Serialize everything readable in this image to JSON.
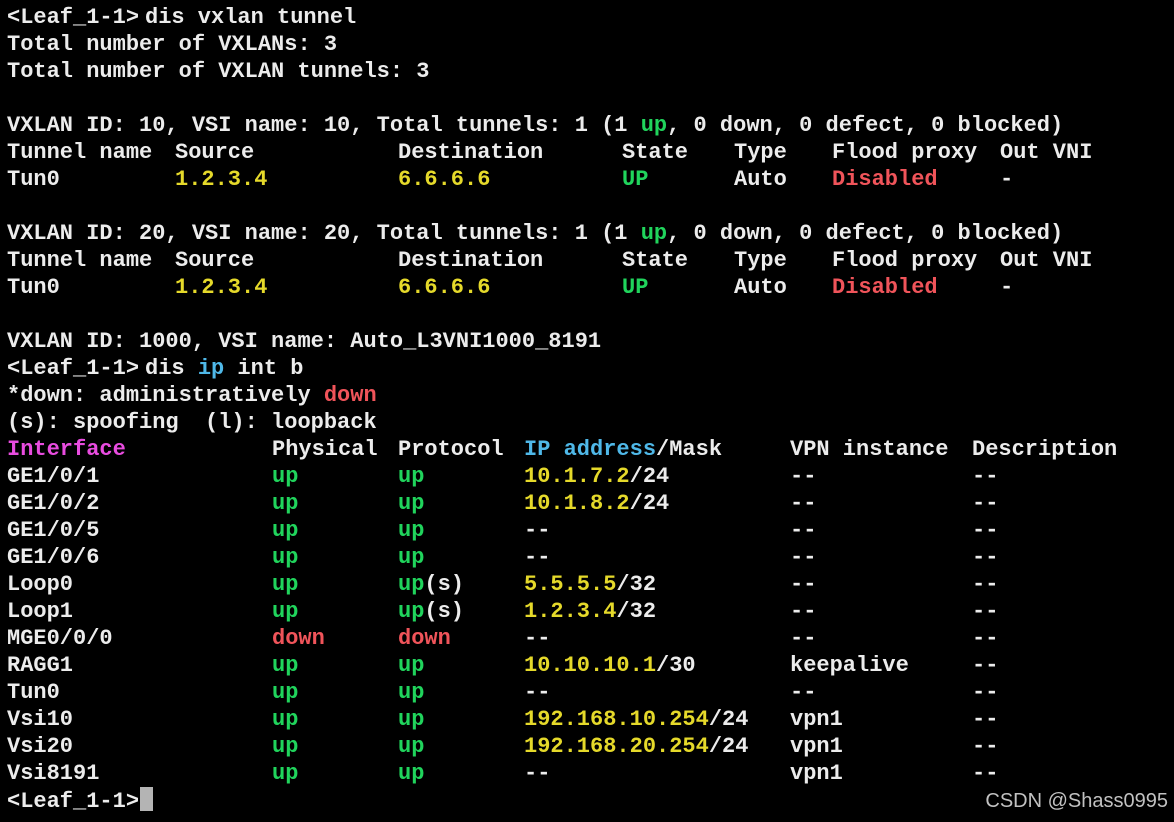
{
  "terminal": {
    "prompt": "<Leaf_1-1>",
    "cmd1": "dis vxlan tunnel",
    "total_vxlans": "Total number of VXLANs: 3",
    "total_tunnels": "Total number of VXLAN tunnels: 3",
    "vxlan_sections": [
      {
        "header_pre": "VXLAN ID: 10, VSI name: 10, Total tunnels: 1 (1 ",
        "header_up": "up",
        "header_post": ", 0 down, 0 defect, 0 blocked)",
        "col_tunnel": "Tunnel name",
        "col_source": "Source",
        "col_dest": "Destination",
        "col_state": "State",
        "col_type": "Type",
        "col_flood": "Flood proxy",
        "col_outvni": "Out VNI",
        "tunnel": "Tun0",
        "source": "1.2.3.4",
        "dest": "6.6.6.6",
        "state": "UP",
        "type": "Auto",
        "flood": "Disabled",
        "outvni": "-"
      },
      {
        "header_pre": "VXLAN ID: 20, VSI name: 20, Total tunnels: 1 (1 ",
        "header_up": "up",
        "header_post": ", 0 down, 0 defect, 0 blocked)",
        "col_tunnel": "Tunnel name",
        "col_source": "Source",
        "col_dest": "Destination",
        "col_state": "State",
        "col_type": "Type",
        "col_flood": "Flood proxy",
        "col_outvni": "Out VNI",
        "tunnel": "Tun0",
        "source": "1.2.3.4",
        "dest": "6.6.6.6",
        "state": "UP",
        "type": "Auto",
        "flood": "Disabled",
        "outvni": "-"
      }
    ],
    "vxlan_1000": "VXLAN ID: 1000, VSI name: Auto_L3VNI1000_8191",
    "cmd2_pre": "dis ",
    "cmd2_ip": "ip",
    "cmd2_post": " int b",
    "legend1_pre": "*down: administratively ",
    "legend1_down": "down",
    "legend2": "(s): spoofing  (l): loopback",
    "ip_header": {
      "interface": "Interface",
      "physical": "Physical",
      "protocol": "Protocol",
      "ipaddr": "IP address",
      "mask": "/Mask",
      "vpn": "VPN instance",
      "desc": "Description"
    },
    "interfaces": [
      {
        "name": "GE1/0/1",
        "phys": "up",
        "proto": "up",
        "proto_suffix": "",
        "ip": "10.1.7.2",
        "mask": "/24",
        "vpn": "--",
        "desc": "--"
      },
      {
        "name": "GE1/0/2",
        "phys": "up",
        "proto": "up",
        "proto_suffix": "",
        "ip": "10.1.8.2",
        "mask": "/24",
        "vpn": "--",
        "desc": "--"
      },
      {
        "name": "GE1/0/5",
        "phys": "up",
        "proto": "up",
        "proto_suffix": "",
        "ip": "--",
        "mask": "",
        "vpn": "--",
        "desc": "--"
      },
      {
        "name": "GE1/0/6",
        "phys": "up",
        "proto": "up",
        "proto_suffix": "",
        "ip": "--",
        "mask": "",
        "vpn": "--",
        "desc": "--"
      },
      {
        "name": "Loop0",
        "phys": "up",
        "proto": "up",
        "proto_suffix": "(s)",
        "ip": "5.5.5.5",
        "mask": "/32",
        "vpn": "--",
        "desc": "--"
      },
      {
        "name": "Loop1",
        "phys": "up",
        "proto": "up",
        "proto_suffix": "(s)",
        "ip": "1.2.3.4",
        "mask": "/32",
        "vpn": "--",
        "desc": "--"
      },
      {
        "name": "MGE0/0/0",
        "phys": "down",
        "proto": "down",
        "proto_suffix": "",
        "ip": "--",
        "mask": "",
        "vpn": "--",
        "desc": "--"
      },
      {
        "name": "RAGG1",
        "phys": "up",
        "proto": "up",
        "proto_suffix": "",
        "ip": "10.10.10.1",
        "mask": "/30",
        "vpn": "keepalive",
        "desc": "--"
      },
      {
        "name": "Tun0",
        "phys": "up",
        "proto": "up",
        "proto_suffix": "",
        "ip": "--",
        "mask": "",
        "vpn": "--",
        "desc": "--"
      },
      {
        "name": "Vsi10",
        "phys": "up",
        "proto": "up",
        "proto_suffix": "",
        "ip": "192.168.10.254",
        "mask": "/24",
        "vpn": "vpn1",
        "desc": "--"
      },
      {
        "name": "Vsi20",
        "phys": "up",
        "proto": "up",
        "proto_suffix": "",
        "ip": "192.168.20.254",
        "mask": "/24",
        "vpn": "vpn1",
        "desc": "--"
      },
      {
        "name": "Vsi8191",
        "phys": "up",
        "proto": "up",
        "proto_suffix": "",
        "ip": "--",
        "mask": "",
        "vpn": "vpn1",
        "desc": "--"
      }
    ]
  },
  "watermark": "CSDN @Shass0995",
  "colors": {
    "background": "#000000",
    "text": "#ececec",
    "up_green": "#20d45c",
    "address_yellow": "#e5d92a",
    "down_red": "#f0545a",
    "keyword_blue": "#4fb8e8",
    "header_magenta": "#e94ce0"
  }
}
